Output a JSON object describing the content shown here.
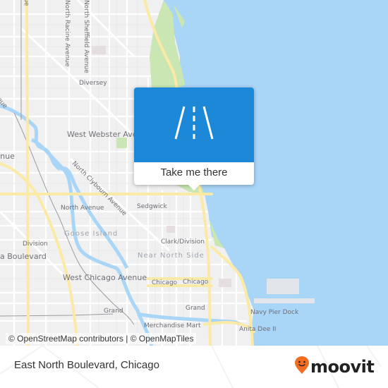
{
  "map": {
    "labels": {
      "north_racine": "North Racine Avenue",
      "north_sheffield": "North Sheffield Avenue",
      "top_left_avenue": "Avenue",
      "diversey": "Diversey",
      "venue_left": "venue",
      "west_webster": "West Webster Avenue",
      "avenue_left": "Avenue",
      "north_clybourn": "North Clybourn Avenue",
      "north_avenue": "North Avenue",
      "sedgwick": "Sedgwick",
      "goose_island": "Goose Island",
      "division": "Division",
      "boulevard_left": "a Boulevard",
      "clark_division": "Clark/Division",
      "near_north_side": "Near North Side",
      "west_chicago": "West Chicago Avenue",
      "chicago_1": "Chicago",
      "chicago_2": "Chicago",
      "grand_1": "Grand",
      "grand_2": "Grand",
      "merchandise_mart": "Merchandise Mart",
      "navy_pier_dock": "Navy Pier Dock",
      "anita_dee": "Anita Dee II"
    },
    "attribution": "© OpenStreetMap contributors | © OpenMapTiles",
    "colors": {
      "water": "#a9d5f7",
      "park": "#c9e6b3",
      "major_road": "#fbe9a6",
      "land": "#f0f0f1"
    }
  },
  "popup": {
    "icon": "road-icon",
    "button_label": "Take me there",
    "color": "#1e88d8"
  },
  "footer": {
    "title": "East North Boulevard, Chicago",
    "brand": "moovit",
    "brand_color": "#f26c21"
  }
}
